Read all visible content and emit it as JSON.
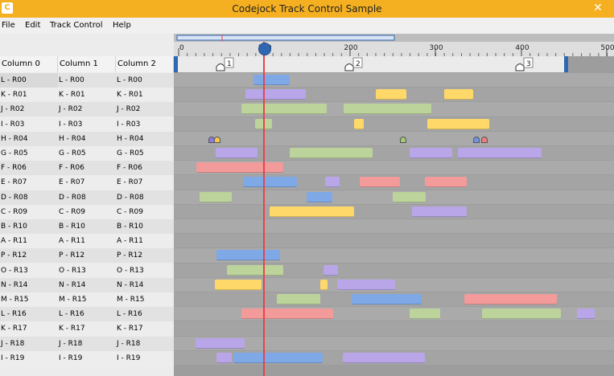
{
  "window": {
    "title": "Codejock Track Control Sample",
    "close_glyph": "✕",
    "app_icon_glyph": "C"
  },
  "menu": [
    {
      "label": "File"
    },
    {
      "label": "Edit"
    },
    {
      "label": "Track Control"
    },
    {
      "label": "Help"
    }
  ],
  "columns": [
    "Column 0",
    "Column 1",
    "Column 2"
  ],
  "rows": [
    [
      "L - R00",
      "L - R00",
      "L - R00"
    ],
    [
      "K - R01",
      "K - R01",
      "K - R01"
    ],
    [
      "J - R02",
      "J - R02",
      "J - R02"
    ],
    [
      "I - R03",
      "I - R03",
      "I - R03"
    ],
    [
      "H - R04",
      "H - R04",
      "H - R04"
    ],
    [
      "G - R05",
      "G - R05",
      "G - R05"
    ],
    [
      "F - R06",
      "F - R06",
      "F - R06"
    ],
    [
      "E - R07",
      "E - R07",
      "E - R07"
    ],
    [
      "D - R08",
      "D - R08",
      "D - R08"
    ],
    [
      "C - R09",
      "C - R09",
      "C - R09"
    ],
    [
      "B - R10",
      "B - R10",
      "B - R10"
    ],
    [
      "A - R11",
      "A - R11",
      "A - R11"
    ],
    [
      "P - R12",
      "P - R12",
      "P - R12"
    ],
    [
      "O - R13",
      "O - R13",
      "O - R13"
    ],
    [
      "N - R14",
      "N - R14",
      "N - R14"
    ],
    [
      "M - R15",
      "M - R15",
      "M - R15"
    ],
    [
      "L - R16",
      "L - R16",
      "L - R16"
    ],
    [
      "K - R17",
      "K - R17",
      "K - R17"
    ],
    [
      "J - R18",
      "J - R18",
      "J - R18"
    ],
    [
      "I - R19",
      "I - R19",
      "I - R19"
    ]
  ],
  "ruler": {
    "ticks": [
      "0",
      "100",
      "200",
      "300",
      "400",
      "500"
    ]
  },
  "track_markers": [
    {
      "label": "1"
    },
    {
      "label": "2"
    },
    {
      "label": "3"
    }
  ],
  "colors": {
    "blue": "#7ea9e6",
    "purple": "#b8a6e8",
    "yellow": "#ffd86a",
    "green": "#bcd49b",
    "red": "#f39b9b",
    "accent": "#2f67b3",
    "titlebar": "#f5b021",
    "playhead": "#e8434b"
  }
}
